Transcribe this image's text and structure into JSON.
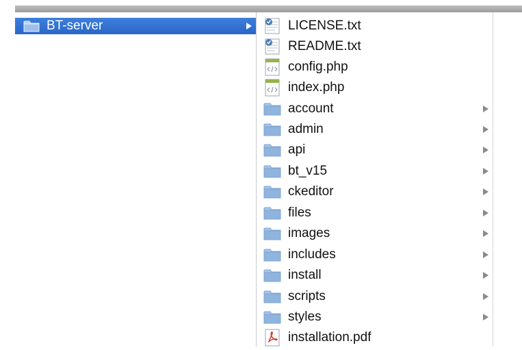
{
  "column1": {
    "selected_folder": "BT-server"
  },
  "column2": {
    "items": [
      {
        "name": "LICENSE.txt",
        "icon": "text-file-icon",
        "has_children": false
      },
      {
        "name": "README.txt",
        "icon": "text-file-icon",
        "has_children": false
      },
      {
        "name": "config.php",
        "icon": "php-file-icon",
        "has_children": false
      },
      {
        "name": "index.php",
        "icon": "php-file-icon",
        "has_children": false
      },
      {
        "name": "account",
        "icon": "folder-icon",
        "has_children": true
      },
      {
        "name": "admin",
        "icon": "folder-icon",
        "has_children": true
      },
      {
        "name": "api",
        "icon": "folder-icon",
        "has_children": true
      },
      {
        "name": "bt_v15",
        "icon": "folder-icon",
        "has_children": true
      },
      {
        "name": "ckeditor",
        "icon": "folder-icon",
        "has_children": true
      },
      {
        "name": "files",
        "icon": "folder-icon",
        "has_children": true
      },
      {
        "name": "images",
        "icon": "folder-icon",
        "has_children": true
      },
      {
        "name": "includes",
        "icon": "folder-icon",
        "has_children": true
      },
      {
        "name": "install",
        "icon": "folder-icon",
        "has_children": true
      },
      {
        "name": "scripts",
        "icon": "folder-icon",
        "has_children": true
      },
      {
        "name": "styles",
        "icon": "folder-icon",
        "has_children": true
      },
      {
        "name": "installation.pdf",
        "icon": "pdf-file-icon",
        "has_children": false
      }
    ]
  },
  "colors": {
    "selection": "#2f6fd3",
    "folder": "#8fb4de",
    "chevron": "#8a8a8a"
  }
}
